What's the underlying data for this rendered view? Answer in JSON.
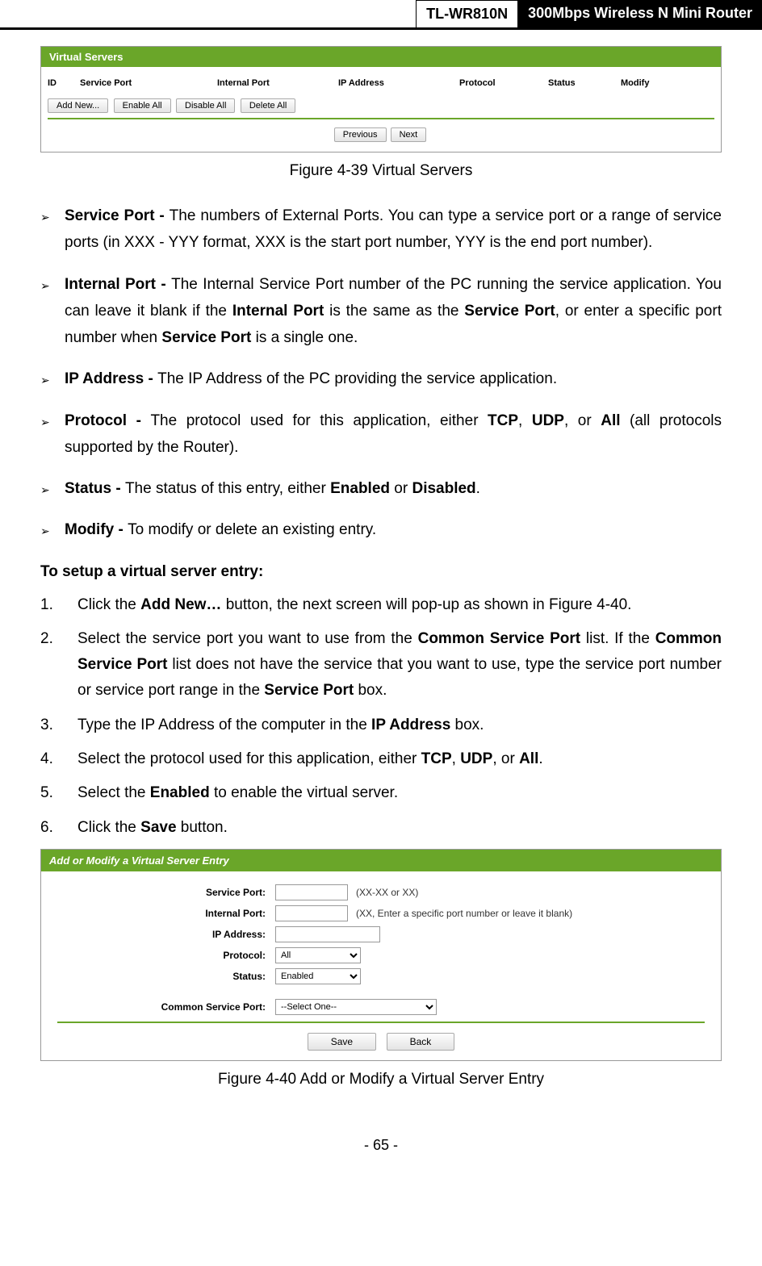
{
  "header": {
    "model": "TL-WR810N",
    "desc": "300Mbps Wireless N Mini Router"
  },
  "screenshot1": {
    "title": "Virtual Servers",
    "cols": {
      "id": "ID",
      "sp": "Service Port",
      "ip": "Internal Port",
      "addr": "IP Address",
      "proto": "Protocol",
      "stat": "Status",
      "mod": "Modify"
    },
    "buttons": {
      "add": "Add New...",
      "enable": "Enable All",
      "disable": "Disable All",
      "delete": "Delete All"
    },
    "pag": {
      "prev": "Previous",
      "next": "Next"
    }
  },
  "caption1": "Figure 4-39 Virtual Servers",
  "bullets": [
    {
      "label": "Service Port - ",
      "text": "The numbers of External Ports. You can type a service port or a range of service ports (in XXX - YYY format, XXX is the start port number, YYY is the end port number)."
    },
    {
      "label": "Internal Port - ",
      "text_parts": [
        "The Internal Service Port number of the PC running the service application. You can leave it blank if the ",
        "Internal Port",
        " is the same as the ",
        "Service Port",
        ", or enter a specific port number when ",
        "Service Port",
        " is a single one."
      ]
    },
    {
      "label": "IP Address - ",
      "text": "The IP Address of the PC providing the service application."
    },
    {
      "label": "Protocol - ",
      "text_parts": [
        "The protocol used for this application, either ",
        "TCP",
        ", ",
        "UDP",
        ", or ",
        "All",
        " (all protocols supported by the Router)."
      ]
    },
    {
      "label": "Status - ",
      "text_parts": [
        "The status of this entry, either ",
        "Enabled",
        " or ",
        "Disabled",
        "."
      ]
    },
    {
      "label": "Modify - ",
      "text": "To modify or delete an existing entry."
    }
  ],
  "setup_heading": "To setup a virtual server entry:",
  "steps": [
    {
      "num": "1.",
      "parts": [
        "Click the ",
        "Add New…",
        " button, the next screen will pop-up as shown in Figure 4-40."
      ]
    },
    {
      "num": "2.",
      "parts": [
        "Select the service port you want to use from the ",
        "Common Service Port",
        " list. If the ",
        "Common Service Port",
        " list does not have the service that you want to use, type the service port number or service port range in the ",
        "Service Port",
        " box."
      ]
    },
    {
      "num": "3.",
      "parts": [
        "Type the IP Address of the computer in the ",
        "IP Address",
        " box."
      ]
    },
    {
      "num": "4.",
      "parts": [
        "Select the protocol used for this application, either ",
        "TCP",
        ", ",
        "UDP",
        ", or ",
        "All",
        "."
      ]
    },
    {
      "num": "5.",
      "parts": [
        "Select the ",
        "Enabled",
        " to enable the virtual server."
      ]
    },
    {
      "num": "6.",
      "parts": [
        "Click the ",
        "Save",
        " button."
      ]
    }
  ],
  "screenshot2": {
    "title": "Add or Modify a Virtual Server Entry",
    "labels": {
      "sp": "Service Port:",
      "ip": "Internal Port:",
      "addr": "IP Address:",
      "proto": "Protocol:",
      "stat": "Status:",
      "csp": "Common Service Port:"
    },
    "hints": {
      "sp": "(XX-XX or XX)",
      "ip": "(XX, Enter a specific port number or leave it blank)"
    },
    "values": {
      "proto": "All",
      "stat": "Enabled",
      "csp": "--Select One--"
    },
    "buttons": {
      "save": "Save",
      "back": "Back"
    }
  },
  "caption2": "Figure 4-40    Add or Modify a Virtual Server Entry",
  "footer": "- 65 -"
}
